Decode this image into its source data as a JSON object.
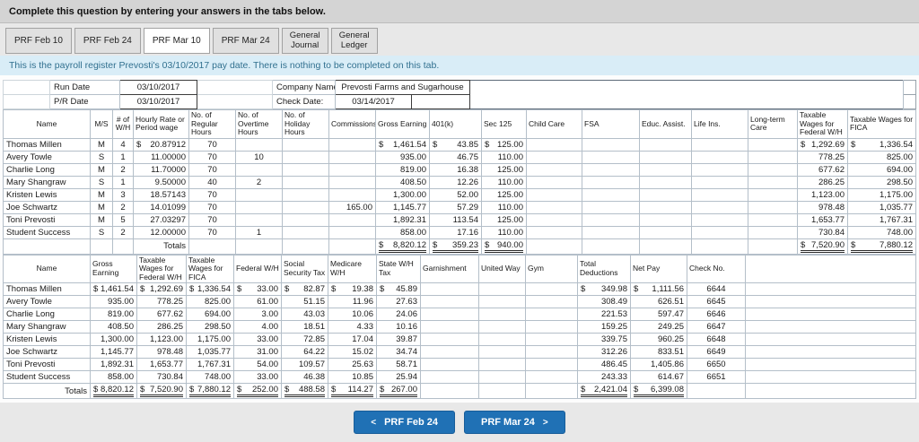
{
  "instruction_bar": {
    "text": "Complete this question by entering your answers in the tabs below."
  },
  "tabs": [
    {
      "label": "PRF Feb 10",
      "active": false
    },
    {
      "label": "PRF Feb 24",
      "active": false
    },
    {
      "label": "PRF Mar 10",
      "active": true
    },
    {
      "label": "PRF Mar 24",
      "active": false
    },
    {
      "label": "General Journal",
      "active": false
    },
    {
      "label": "General Ledger",
      "active": false
    }
  ],
  "info_banner": {
    "text": "This is the payroll register Prevosti's 03/10/2017 pay date. There is nothing to be completed on this tab."
  },
  "register_header": {
    "run_date_label": "Run Date",
    "run_date_value": "03/10/2017",
    "pr_date_label": "P/R Date",
    "pr_date_value": "03/10/2017",
    "company_name_label": "Company Name:",
    "company_name_value": "Prevosti Farms and Sugarhouse",
    "check_date_label": "Check Date:",
    "check_date_value": "03/14/2017"
  },
  "earnings_table": {
    "columns": [
      "Name",
      "M/S",
      "# of W/H",
      "Hourly Rate or Period wage",
      "No. of Regular Hours",
      "No. of Overtime Hours",
      "No. of Holiday Hours",
      "Commissions",
      "Gross Earning",
      "401(k)",
      "Sec 125",
      "Child Care",
      "FSA",
      "Educ. Assist.",
      "Life Ins.",
      "Long-term Care",
      "Taxable Wages for Federal W/H",
      "Taxable Wages for FICA"
    ],
    "rows": [
      [
        "Thomas Millen",
        "M",
        "4",
        "$ 20.87912",
        "70",
        "",
        "",
        "",
        "$ 1,461.54",
        "$ 43.85",
        "$ 125.00",
        "",
        "",
        "",
        "",
        "",
        "$ 1,292.69",
        "$ 1,336.54"
      ],
      [
        "Avery Towle",
        "S",
        "1",
        "11.00000",
        "70",
        "10",
        "",
        "",
        "935.00",
        "46.75",
        "110.00",
        "",
        "",
        "",
        "",
        "",
        "778.25",
        "825.00"
      ],
      [
        "Charlie Long",
        "M",
        "2",
        "11.70000",
        "70",
        "",
        "",
        "",
        "819.00",
        "16.38",
        "125.00",
        "",
        "",
        "",
        "",
        "",
        "677.62",
        "694.00"
      ],
      [
        "Mary Shangraw",
        "S",
        "1",
        "9.50000",
        "40",
        "2",
        "",
        "",
        "408.50",
        "12.26",
        "110.00",
        "",
        "",
        "",
        "",
        "",
        "286.25",
        "298.50"
      ],
      [
        "Kristen Lewis",
        "M",
        "3",
        "18.57143",
        "70",
        "",
        "",
        "",
        "1,300.00",
        "52.00",
        "125.00",
        "",
        "",
        "",
        "",
        "",
        "1,123.00",
        "1,175.00"
      ],
      [
        "Joe Schwartz",
        "M",
        "2",
        "14.01099",
        "70",
        "",
        "",
        "165.00",
        "1,145.77",
        "57.29",
        "110.00",
        "",
        "",
        "",
        "",
        "",
        "978.48",
        "1,035.77"
      ],
      [
        "Toni Prevosti",
        "M",
        "5",
        "27.03297",
        "70",
        "",
        "",
        "",
        "1,892.31",
        "113.54",
        "125.00",
        "",
        "",
        "",
        "",
        "",
        "1,653.77",
        "1,767.31"
      ],
      [
        "Student Success",
        "S",
        "2",
        "12.00000",
        "70",
        "1",
        "",
        "",
        "858.00",
        "17.16",
        "110.00",
        "",
        "",
        "",
        "",
        "",
        "730.84",
        "748.00"
      ]
    ],
    "totals_row": [
      "",
      "",
      "",
      "Totals",
      "",
      "",
      "",
      "",
      "$ 8,820.12",
      "$ 359.23",
      "$ 940.00",
      "",
      "",
      "",
      "",
      "",
      "$ 7,520.90",
      "$ 7,880.12"
    ]
  },
  "deductions_table": {
    "columns": [
      "Name",
      "Gross Earning",
      "Taxable Wages for Federal W/H",
      "Taxable Wages for FICA",
      "Federal W/H",
      "Social Security Tax",
      "Medicare W/H",
      "State W/H Tax",
      "Garnishment",
      "United Way",
      "Gym",
      "Total Deductions",
      "Net Pay",
      "Check No."
    ],
    "rows": [
      [
        "Thomas Millen",
        "$ 1,461.54",
        "$ 1,292.69",
        "$ 1,336.54",
        "$ 33.00",
        "$ 82.87",
        "$ 19.38",
        "$ 45.89",
        "",
        "",
        "",
        "$ 349.98",
        "$ 1,111.56",
        "6644"
      ],
      [
        "Avery Towle",
        "935.00",
        "778.25",
        "825.00",
        "61.00",
        "51.15",
        "11.96",
        "27.63",
        "",
        "",
        "",
        "308.49",
        "626.51",
        "6645"
      ],
      [
        "Charlie Long",
        "819.00",
        "677.62",
        "694.00",
        "3.00",
        "43.03",
        "10.06",
        "24.06",
        "",
        "",
        "",
        "221.53",
        "597.47",
        "6646"
      ],
      [
        "Mary Shangraw",
        "408.50",
        "286.25",
        "298.50",
        "4.00",
        "18.51",
        "4.33",
        "10.16",
        "",
        "",
        "",
        "159.25",
        "249.25",
        "6647"
      ],
      [
        "Kristen Lewis",
        "1,300.00",
        "1,123.00",
        "1,175.00",
        "33.00",
        "72.85",
        "17.04",
        "39.87",
        "",
        "",
        "",
        "339.75",
        "960.25",
        "6648"
      ],
      [
        "Joe Schwartz",
        "1,145.77",
        "978.48",
        "1,035.77",
        "31.00",
        "64.22",
        "15.02",
        "34.74",
        "",
        "",
        "",
        "312.26",
        "833.51",
        "6649"
      ],
      [
        "Toni Prevosti",
        "1,892.31",
        "1,653.77",
        "1,767.31",
        "54.00",
        "109.57",
        "25.63",
        "58.71",
        "",
        "",
        "",
        "486.45",
        "1,405.86",
        "6650"
      ],
      [
        "Student Success",
        "858.00",
        "730.84",
        "748.00",
        "33.00",
        "46.38",
        "10.85",
        "25.94",
        "",
        "",
        "",
        "243.33",
        "614.67",
        "6651"
      ]
    ],
    "totals_row": [
      "Totals",
      "$ 8,820.12",
      "$ 7,520.90",
      "$ 7,880.12",
      "$ 252.00",
      "$ 488.58",
      "$ 114.27",
      "$ 267.00",
      "",
      "",
      "",
      "$ 2,421.04",
      "$ 6,399.08",
      ""
    ]
  },
  "footer_nav": {
    "prev_icon": "<",
    "prev_label": "PRF Feb 24",
    "next_label": "PRF Mar 24",
    "next_icon": ">"
  },
  "colors": {
    "accent_button": "#2071b5",
    "info_banner_bg": "#d9edf7",
    "info_banner_text": "#31708f"
  }
}
